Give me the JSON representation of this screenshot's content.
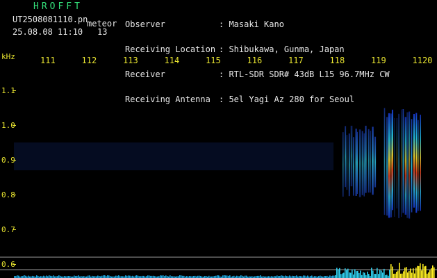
{
  "header": {
    "app_title": "HROFFT",
    "file_name": "UT2508081110.pn",
    "meteor_label": "meteor",
    "timestamp": "25.08.08 11:10",
    "count": "13",
    "fields": [
      {
        "label": "Observer",
        "value": ": Masaki Kano"
      },
      {
        "label": "Receiving Location",
        "value": ": Shibukawa, Gunma, Japan"
      },
      {
        "label": "Receiver",
        "value": ": RTL-SDR SDR# 43dB L15 96.7MHz CW"
      },
      {
        "label": "Receiving Antenna",
        "value": ": 5el Yagi Az 280 for Seoul"
      }
    ]
  },
  "colors": {
    "title": "#33e07a",
    "labels": "#e8e8e8",
    "axis": "#e8e430",
    "background": "#000000",
    "noise": "#0b1a4a"
  },
  "chart_data": {
    "type": "heatmap",
    "ylabel": "kHz",
    "x_ticks": [
      "111",
      "112",
      "113",
      "114",
      "115",
      "116",
      "117",
      "118",
      "119",
      "1120"
    ],
    "y_ticks": [
      "1.1",
      "1.0",
      "0.9",
      "0.8",
      "0.7",
      "0.6"
    ],
    "ylim": [
      0.6,
      1.1
    ],
    "grid": false,
    "bursts": [
      {
        "x_start": 1118.2,
        "x_end": 1119.0,
        "f_low": 0.79,
        "f_high": 1.0,
        "intensity": "medium"
      },
      {
        "x_start": 1119.2,
        "x_end": 1120.1,
        "f_low": 0.73,
        "f_high": 1.05,
        "intensity": "high"
      }
    ]
  }
}
